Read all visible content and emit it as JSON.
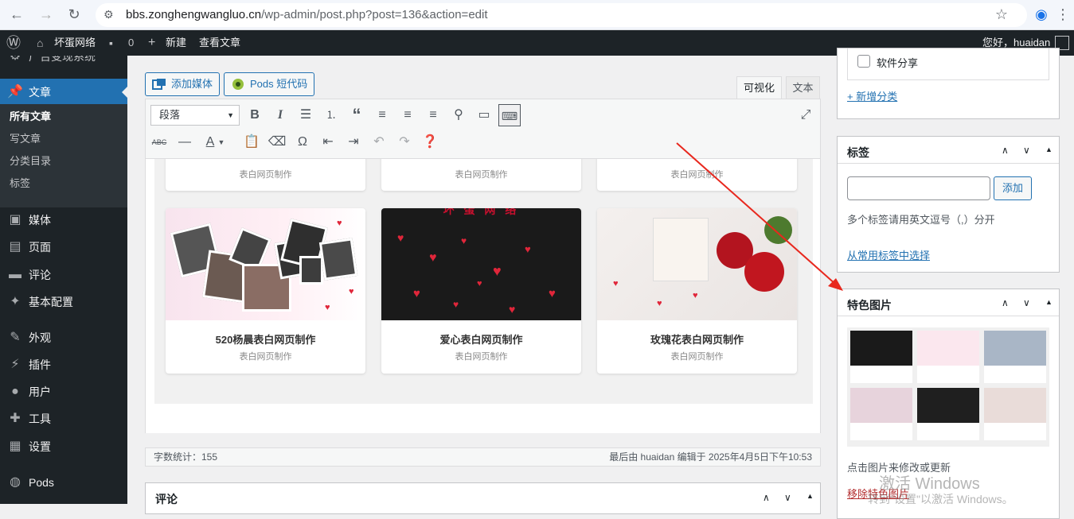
{
  "browser": {
    "url_host": "bbs.zonghengwangluo.cn",
    "url_path": "/wp-admin/post.php?post=136&action=edit"
  },
  "adminbar": {
    "site_name": "坏蛋网络",
    "comments_count": "0",
    "new_label": "新建",
    "view_label": "查看文章",
    "greeting": "您好，huaidan"
  },
  "sidebar": {
    "partial_top": "广告变现系统",
    "posts_label": "文章",
    "submenu": [
      "所有文章",
      "写文章",
      "分类目录",
      "标签"
    ],
    "items": [
      {
        "label": "媒体",
        "icon": "media-icon"
      },
      {
        "label": "页面",
        "icon": "page-icon"
      },
      {
        "label": "评论",
        "icon": "comment-icon"
      },
      {
        "label": "基本配置",
        "icon": "pin-icon"
      },
      {
        "label": "外观",
        "icon": "brush-icon"
      },
      {
        "label": "插件",
        "icon": "plugin-icon"
      },
      {
        "label": "用户",
        "icon": "user-icon"
      },
      {
        "label": "工具",
        "icon": "wrench-icon"
      },
      {
        "label": "设置",
        "icon": "settings-icon"
      },
      {
        "label": "Pods",
        "icon": "pods-icon"
      }
    ]
  },
  "editor": {
    "add_media": "添加媒体",
    "pods_shortcode": "Pods 短代码",
    "tab_visual": "可视化",
    "tab_text": "文本",
    "format": "段落",
    "cards_top_sub": [
      "表白网页制作",
      "表白网页制作",
      "表白网页制作"
    ],
    "cards": [
      {
        "title": "520杨晨表白网页制作",
        "sub": "表白网页制作"
      },
      {
        "title": "爱心表白网页制作",
        "sub": "表白网页制作"
      },
      {
        "title": "玫瑰花表白网页制作",
        "sub": "表白网页制作"
      }
    ],
    "card2_banner": "坏 蛋 网 络",
    "word_count": "字数统计：155",
    "last_edit": "最后由 huaidan 编辑于 2025年4月5日下午10:53"
  },
  "comments_box": {
    "title": "评论"
  },
  "categories": {
    "item": "软件分享",
    "add_new": "+ 新增分类"
  },
  "tags": {
    "title": "标签",
    "add_button": "添加",
    "hint": "多个标签请用英文逗号（,）分开",
    "choose_link": "从常用标签中选择"
  },
  "featured": {
    "title": "特色图片",
    "hint": "点击图片来修改或更新",
    "remove": "移除特色图片"
  },
  "watermark": {
    "line1": "激活 Windows",
    "line2": "转到\"设置\"以激活 Windows。"
  },
  "colors": {
    "admin_dark": "#1d2327",
    "accent": "#2271b1",
    "arrow": "#e8281e"
  }
}
